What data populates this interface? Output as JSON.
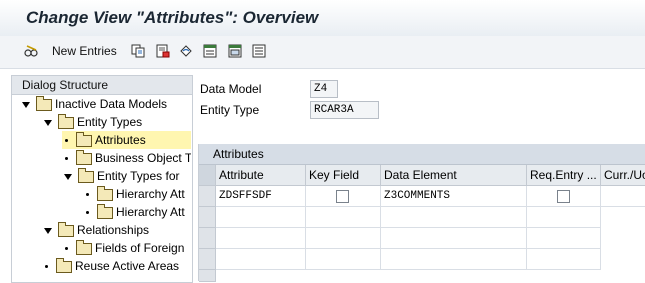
{
  "title": "Change View \"Attributes\": Overview",
  "toolbar": {
    "new_entries_label": "New Entries",
    "icons": [
      "edit-glasses-icon",
      "copy-icon",
      "delete-icon",
      "undo-icon",
      "select-all-icon",
      "select-block-icon",
      "deselect-all-icon"
    ]
  },
  "dialog_structure": {
    "header": "Dialog Structure",
    "items": [
      {
        "label": "Inactive Data Models",
        "expander": "down"
      },
      {
        "label": "Entity Types",
        "expander": "down"
      },
      {
        "label": "Attributes",
        "expander": "bullet",
        "selected": true
      },
      {
        "label": "Business Object T",
        "expander": "bullet"
      },
      {
        "label": "Entity Types for",
        "expander": "down"
      },
      {
        "label": "Hierarchy Att",
        "expander": "bullet"
      },
      {
        "label": "Hierarchy Att",
        "expander": "bullet"
      },
      {
        "label": "Relationships",
        "expander": "down"
      },
      {
        "label": "Fields of Foreign",
        "expander": "bullet"
      },
      {
        "label": "Reuse Active Areas",
        "expander": "bullet"
      }
    ]
  },
  "form": {
    "data_model_label": "Data Model",
    "data_model_value": "Z4",
    "entity_type_label": "Entity Type",
    "entity_type_value": "RCAR3A"
  },
  "attributes_table": {
    "title": "Attributes",
    "columns": [
      "Attribute",
      "Key Field",
      "Data Element",
      "Req.Entry ...",
      "Curr./Uo"
    ],
    "rows": [
      {
        "attribute": "ZDSFFSDF",
        "key_field": false,
        "data_element": "Z3COMMENTS",
        "req_entry": false,
        "curr": ""
      }
    ]
  }
}
